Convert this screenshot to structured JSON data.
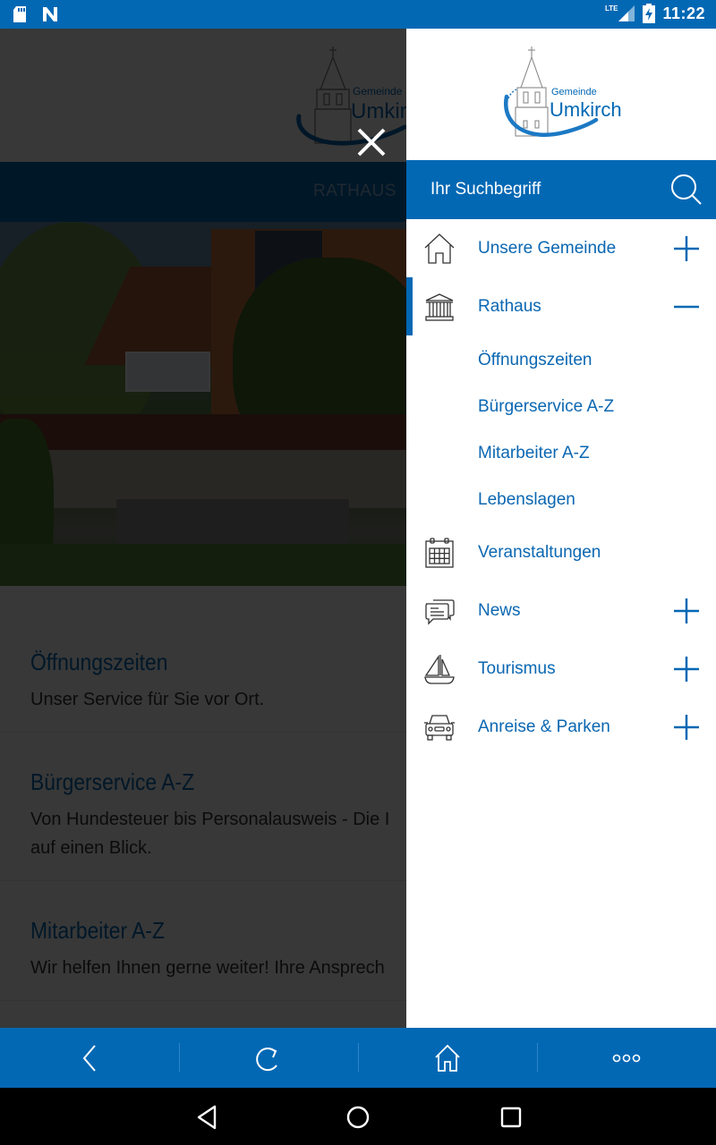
{
  "status_bar": {
    "left_icons": [
      "sd-card-icon",
      "n-notification-icon"
    ],
    "network": "LTE",
    "battery": "charging",
    "time": "11:22"
  },
  "background_page": {
    "logo": {
      "small": "Gemeinde",
      "big": "Umkirch"
    },
    "nav_title": "RATHAUS",
    "items": [
      {
        "title": "Öffnungszeiten",
        "desc_lines": [
          "Unser Service für Sie vor Ort."
        ]
      },
      {
        "title": "Bürgerservice A-Z",
        "desc_lines": [
          "Von Hundesteuer bis Personalausweis - Die I",
          "auf einen Blick."
        ]
      },
      {
        "title": "Mitarbeiter A-Z",
        "desc_lines": [
          "Wir helfen Ihnen gerne weiter! Ihre Ansprech"
        ]
      }
    ]
  },
  "drawer": {
    "logo": {
      "small": "Gemeinde",
      "big": "Umkirch"
    },
    "search": {
      "placeholder": "Ihr Suchbegriff",
      "value": ""
    },
    "menu": [
      {
        "label": "Unsere Gemeinde",
        "icon": "house-icon",
        "toggle": "+",
        "expanded": false,
        "active": false
      },
      {
        "label": "Rathaus",
        "icon": "town-hall-icon",
        "toggle": "−",
        "expanded": true,
        "active": true,
        "children": [
          "Öffnungszeiten",
          "Bürgerservice A-Z",
          "Mitarbeiter A-Z",
          "Lebenslagen"
        ]
      },
      {
        "label": "Veranstaltungen",
        "icon": "calendar-icon",
        "toggle": null,
        "expanded": false,
        "active": false
      },
      {
        "label": "News",
        "icon": "speech-bubbles-icon",
        "toggle": "+",
        "expanded": false,
        "active": false
      },
      {
        "label": "Tourismus",
        "icon": "sailboat-icon",
        "toggle": "+",
        "expanded": false,
        "active": false
      },
      {
        "label": "Anreise & Parken",
        "icon": "car-icon",
        "toggle": "+",
        "expanded": false,
        "active": false
      }
    ]
  },
  "toolbar": {
    "buttons": [
      {
        "name": "back",
        "icon": "chevron-left-icon"
      },
      {
        "name": "reload",
        "icon": "reload-icon"
      },
      {
        "name": "home",
        "icon": "home-icon"
      },
      {
        "name": "more",
        "icon": "more-dots-icon"
      }
    ]
  },
  "android_nav": [
    "back",
    "home",
    "recents"
  ],
  "colors": {
    "brand_blue": "#0368b4",
    "link_blue": "#0a67b2"
  }
}
